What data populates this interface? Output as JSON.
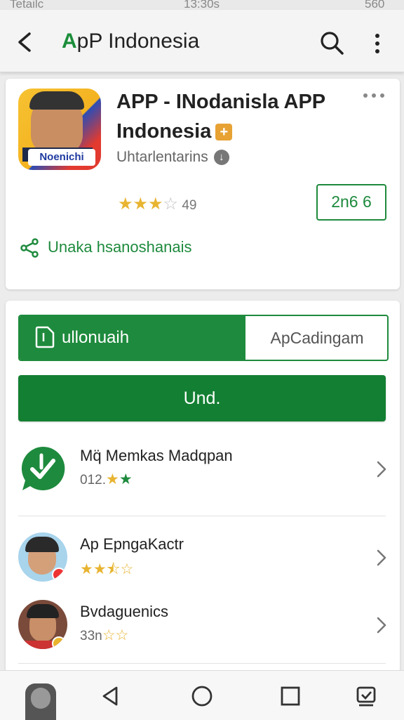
{
  "status_bar": {
    "carrier": "Tetailc",
    "time": "13:30s",
    "battery": "560"
  },
  "header": {
    "title_prefix": "A",
    "title_rest": "pP Indonesia"
  },
  "app": {
    "title_line1": "APP - INodanisla APP",
    "title_line2": "Indonesia",
    "title_badge": "+",
    "icon_label": "Noenichi",
    "developer": "Uhtarlentarins",
    "rating_stars": 3,
    "rating_max": 5,
    "rating_count": "49",
    "install_chip": "2n6 6",
    "share_label": "Unaka hsanoshanais"
  },
  "actions": {
    "toggle_left": "ullonuaih",
    "toggle_right": "ApCadingam",
    "primary_button": "Und."
  },
  "related": [
    {
      "title": "Mq̈ Memkas Madqpan",
      "sub": "012.",
      "stars": "gold-green"
    },
    {
      "title": "Ap EpngaKactr",
      "sub": "",
      "stars": "2.5"
    },
    {
      "title": "Bvdaguenics",
      "sub": "33n",
      "stars": "outline"
    }
  ],
  "colors": {
    "accent_green": "#1e8a3d",
    "star_gold": "#e8b431",
    "badge_orange": "#e7a233"
  },
  "icons": [
    "back-arrow-icon",
    "search-icon",
    "more-vert-icon",
    "more-horiz-icon",
    "verified-icon",
    "star-icon",
    "share-icon",
    "document-icon",
    "chevron-right-icon",
    "nav-back-icon",
    "nav-home-icon",
    "nav-recents-icon",
    "nav-assist-icon"
  ]
}
